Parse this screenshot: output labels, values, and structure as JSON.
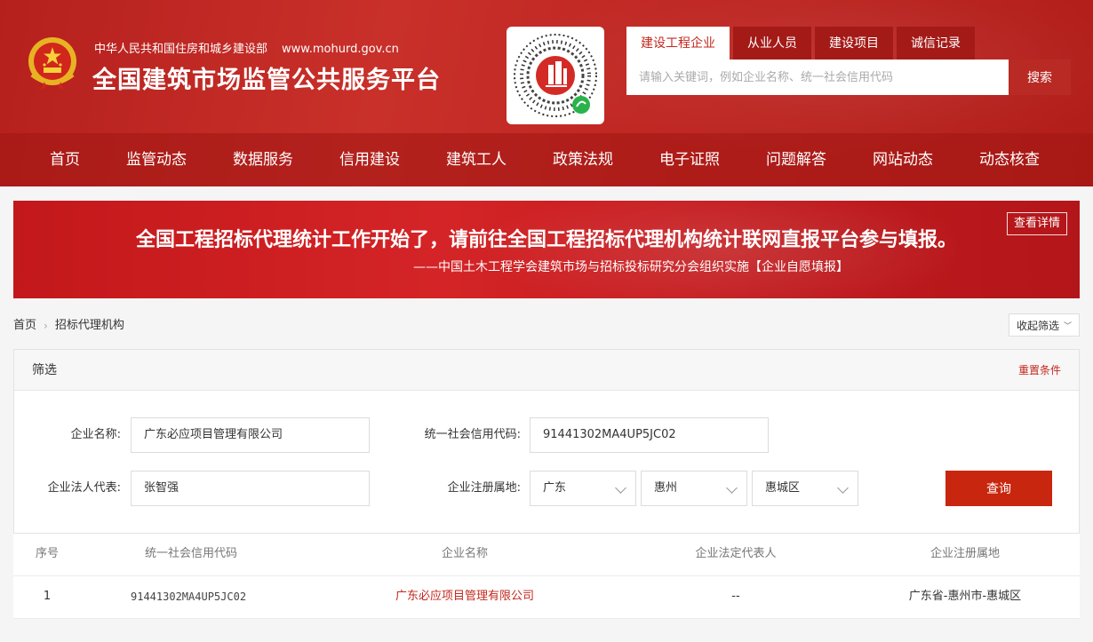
{
  "header": {
    "ministry": "中华人民共和国住房和城乡建设部",
    "url": "www.mohurd.gov.cn",
    "title": "全国建筑市场监管公共服务平台",
    "emblem_icon": "national-emblem-icon",
    "qr_icon": "mini-program-qr-code-icon",
    "colors": {
      "header_red": "#bf2622",
      "accent_red": "#c3281f",
      "button_red": "#c8260e"
    }
  },
  "search": {
    "tabs": [
      {
        "label": "建设工程企业",
        "active": true
      },
      {
        "label": "从业人员",
        "active": false
      },
      {
        "label": "建设项目",
        "active": false
      },
      {
        "label": "诚信记录",
        "active": false
      }
    ],
    "placeholder": "请输入关键词，例如企业名称、统一社会信用代码",
    "button": "搜索"
  },
  "nav": {
    "items": [
      "首页",
      "监管动态",
      "数据服务",
      "信用建设",
      "建筑工人",
      "政策法规",
      "电子证照",
      "问题解答",
      "网站动态",
      "动态核查"
    ]
  },
  "banner": {
    "main": "全国工程招标代理统计工作开始了，请前往全国工程招标代理机构统计联网直报平台参与填报。",
    "sub": "——中国土木工程学会建筑市场与招标投标研究分会组织实施【企业自愿填报】",
    "detail_button": "查看详情"
  },
  "breadcrumb": {
    "home": "首页",
    "current": "招标代理机构",
    "collapse": "收起筛选"
  },
  "filter": {
    "title": "筛选",
    "reset": "重置条件",
    "company_name_label": "企业名称:",
    "company_name_value": "广东必应项目管理有限公司",
    "credit_code_label": "统一社会信用代码:",
    "credit_code_value": "91441302MA4UP5JC02",
    "legal_rep_label": "企业法人代表:",
    "legal_rep_value": "张智强",
    "region_label": "企业注册属地:",
    "province": "广东",
    "city": "惠州",
    "district": "惠城区",
    "query_button": "查询"
  },
  "table": {
    "headers": [
      "序号",
      "统一社会信用代码",
      "企业名称",
      "企业法定代表人",
      "企业注册属地"
    ],
    "rows": [
      {
        "index": "1",
        "credit_code": "91441302MA4UP5JC02",
        "name": "广东必应项目管理有限公司",
        "legal_rep": "--",
        "region": "广东省-惠州市-惠城区"
      }
    ]
  }
}
